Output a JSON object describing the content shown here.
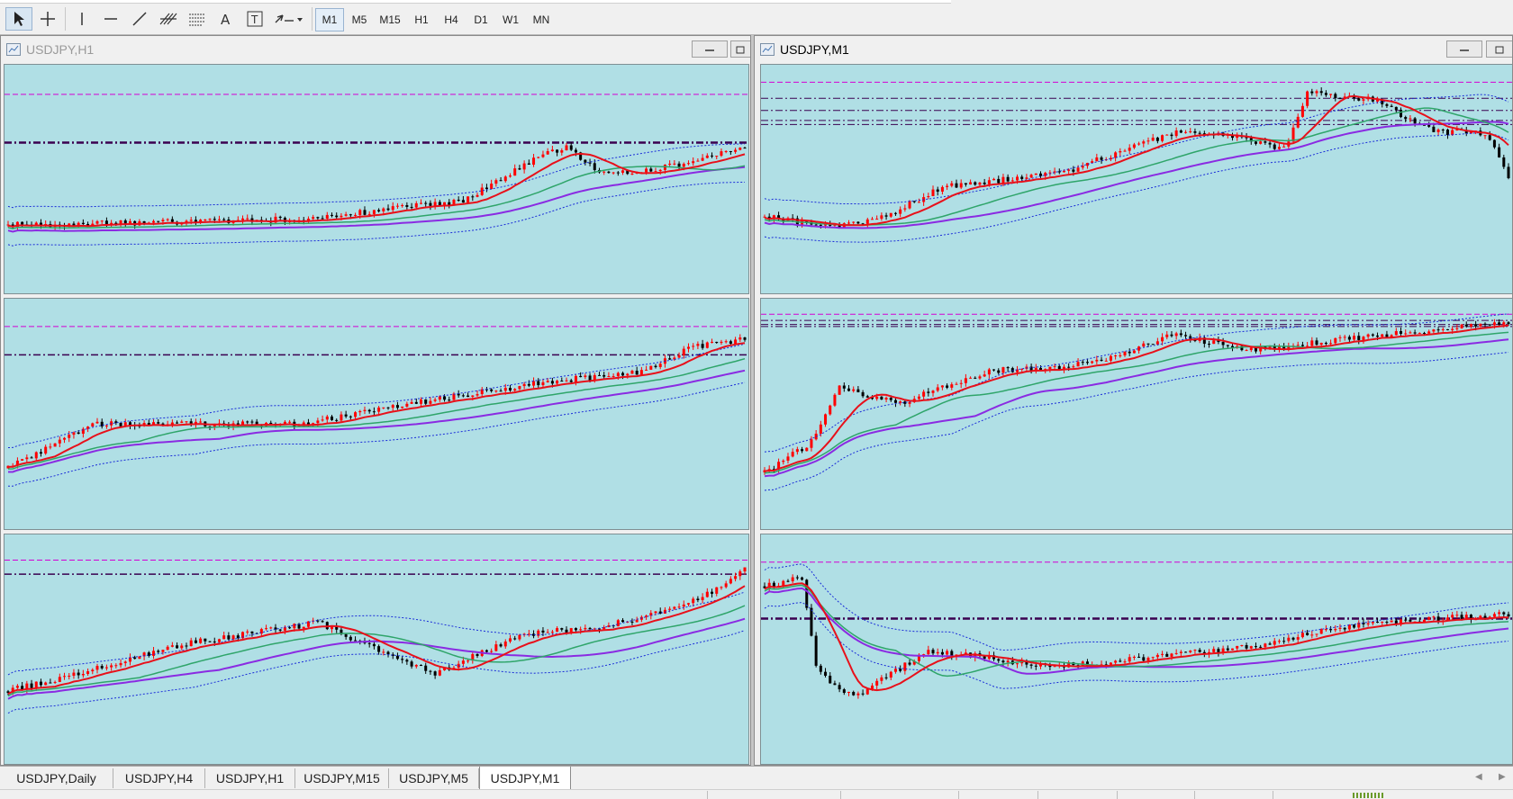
{
  "toolbar": {
    "tools": [
      "cursor",
      "crosshair",
      "vertical-line",
      "horizontal-line",
      "trendline",
      "fibonacci",
      "grid-lines",
      "text",
      "text-label",
      "arrows-menu"
    ],
    "timeframes": [
      "M1",
      "M5",
      "M15",
      "H1",
      "H4",
      "D1",
      "W1",
      "MN"
    ],
    "active_timeframe": "M1"
  },
  "windows": [
    {
      "title": "USDJPY,H1",
      "active": false
    },
    {
      "title": "USDJPY,M1",
      "active": true
    }
  ],
  "tabs": [
    "USDJPY,Daily",
    "USDJPY,H4",
    "USDJPY,H1",
    "USDJPY,M15",
    "USDJPY,M5",
    "USDJPY,M1"
  ],
  "active_tab": "USDJPY,M1",
  "colors": {
    "chart_bg": "#b0dfe5",
    "bull_candle": "#ff0000",
    "bear_candle": "#000000",
    "ma_fast": "#e8101a",
    "ma_mid": "#2fa56a",
    "ma_slow": "#8a2be2",
    "bands": "#1a2cd8",
    "level_magenta": "#d400d4",
    "level_dark": "#3a0050"
  }
}
